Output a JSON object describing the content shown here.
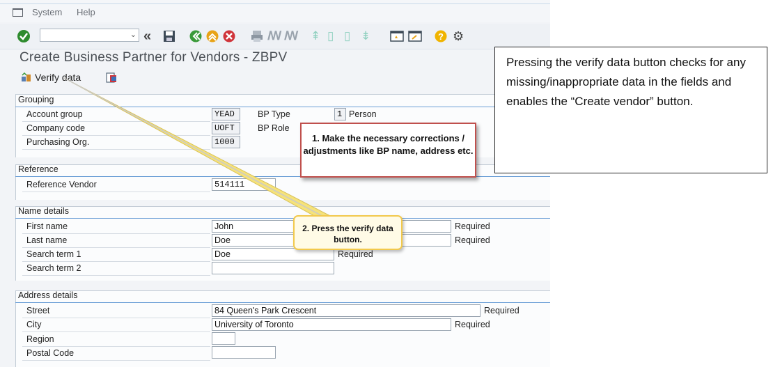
{
  "menu": {
    "items": [
      "System",
      "Help"
    ]
  },
  "toolbar": {
    "command_field_value": "",
    "icons": [
      "enter-icon",
      "back-icon",
      "save-icon",
      "back-green-icon",
      "exit-icon",
      "cancel-icon",
      "print-icon",
      "find-icon",
      "find-next-icon",
      "first-page-icon",
      "previous-page-icon",
      "next-page-icon",
      "last-page-icon",
      "create-session-icon",
      "shortcut-icon",
      "help-icon",
      "customize-icon"
    ]
  },
  "title": "Create Business Partner for Vendors - ZBPV",
  "app_toolbar": {
    "verify_label": "Verify data"
  },
  "grouping": {
    "header": "Grouping",
    "account_group_label": "Account group",
    "account_group_value": "YEAD",
    "company_code_label": "Company code",
    "company_code_value": "UOFT",
    "purch_org_label": "Purchasing Org.",
    "purch_org_value": "1000",
    "bp_type_label": "BP Type",
    "bp_type_value": "1",
    "bp_type_text": "Person",
    "bp_role_label": "BP Role"
  },
  "reference": {
    "header": "Reference",
    "ref_vendor_label": "Reference Vendor",
    "ref_vendor_value": "514111"
  },
  "name_details": {
    "header": "Name details",
    "first_name_label": "First name",
    "first_name_value": "John",
    "last_name_label": "Last name",
    "last_name_value": "Doe",
    "search1_label": "Search term 1",
    "search1_value": "Doe",
    "search2_label": "Search term 2",
    "search2_value": "",
    "required": "Required"
  },
  "address": {
    "header": "Address details",
    "street_label": "Street",
    "street_value": "84 Queen's Park Crescent",
    "city_label": "City",
    "city_value": "University of Toronto",
    "region_label": "Region",
    "region_value": "",
    "postal_label": "Postal Code",
    "postal_value": "",
    "required": "Required"
  },
  "callouts": {
    "step1": "1. Make the necessary corrections / adjustments like BP name, address etc.",
    "step2": "2. Press the verify data button."
  },
  "note": "Pressing the verify data button checks for any missing/inappropriate data in the fields and enables the “Create vendor” button.",
  "colors": {
    "callout1_border": "#c0504d",
    "callout2_border": "#f2c94c",
    "section_line": "#6a9ed6"
  }
}
